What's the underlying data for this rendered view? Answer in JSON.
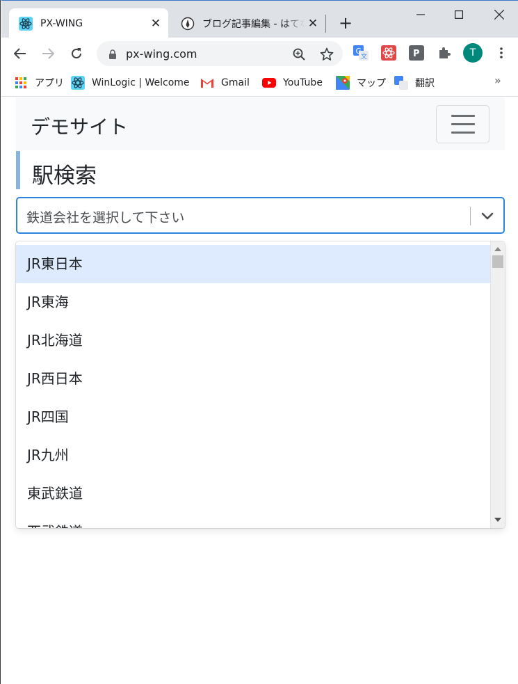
{
  "browser": {
    "tabs": [
      {
        "title": "PX-WING",
        "active": true,
        "close": "✕"
      },
      {
        "title": "ブログ記事編集 - はてなブログ",
        "active": false,
        "close": "✕"
      }
    ],
    "new_tab": "+",
    "address": "px-wing.com",
    "profile_initial": "T",
    "bookmarks": [
      {
        "label": "アプリ"
      },
      {
        "label": "WinLogic | Welcome"
      },
      {
        "label": "Gmail"
      },
      {
        "label": "YouTube"
      },
      {
        "label": "マップ"
      },
      {
        "label": "翻訳"
      }
    ],
    "bookmarks_more": "»"
  },
  "page": {
    "brand": "デモサイト",
    "heading": "駅検索",
    "select": {
      "placeholder": "鉄道会社を選択して下さい",
      "options": [
        "JR東日本",
        "JR東海",
        "JR北海道",
        "JR西日本",
        "JR四国",
        "JR九州",
        "東武鉄道",
        "西武鉄道"
      ],
      "highlighted_index": 0
    }
  },
  "colors": {
    "accent": "#2c84db",
    "highlight": "#deebff",
    "heading_bar": "#88b5e0"
  }
}
